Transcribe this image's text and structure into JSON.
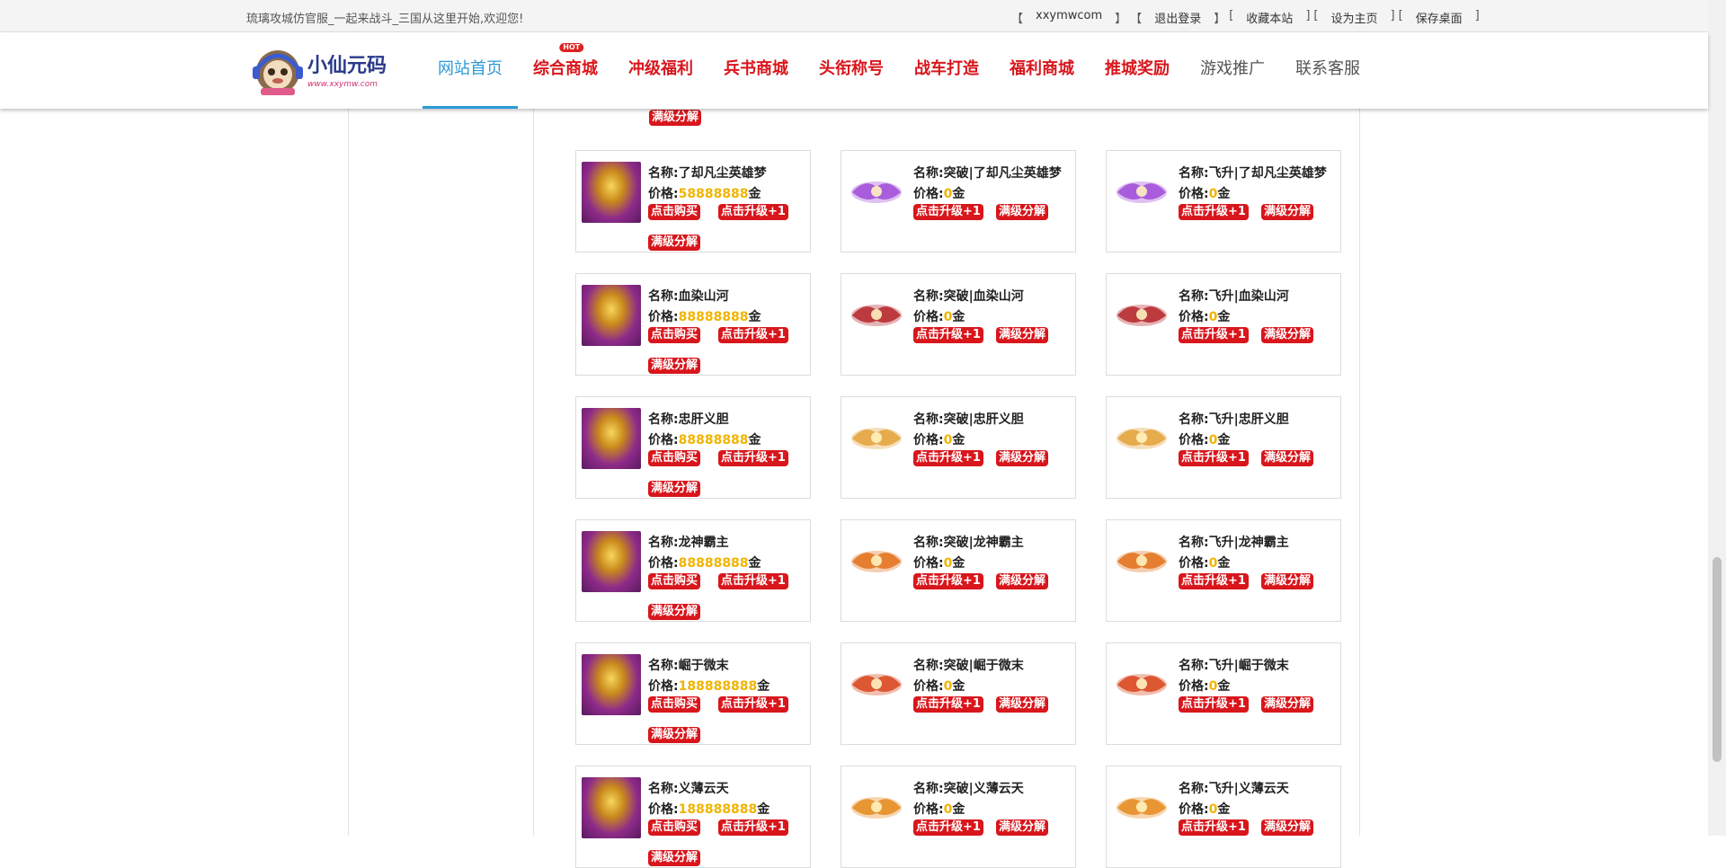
{
  "topbar": {
    "welcome": "琉璃攻城仿官服_一起来战斗_三国从这里开始,欢迎您!",
    "links": [
      "xxymwcom",
      "退出登录",
      "收藏本站",
      "设为主页",
      "保存桌面"
    ]
  },
  "logo": {
    "title": "小仙元码",
    "subtitle": "www.xxymw.com"
  },
  "nav": {
    "hot_badge": "HOT",
    "items": [
      {
        "label": "网站首页",
        "style": "active"
      },
      {
        "label": "综合商城",
        "style": "red",
        "hot": true
      },
      {
        "label": "冲级福利",
        "style": "red"
      },
      {
        "label": "兵书商城",
        "style": "red"
      },
      {
        "label": "头衔称号",
        "style": "red"
      },
      {
        "label": "战车打造",
        "style": "red"
      },
      {
        "label": "福利商城",
        "style": "red"
      },
      {
        "label": "推城奖励",
        "style": "red"
      },
      {
        "label": "游戏推广",
        "style": "gray"
      },
      {
        "label": "联系客服",
        "style": "gray"
      }
    ]
  },
  "labels": {
    "name": "名称:",
    "price": "价格:",
    "currency": "金",
    "buy": "点击购买",
    "upgrade": "点击升级+1",
    "disassemble": "满级分解"
  },
  "rows": [
    {
      "base": "了却凡尘英雄梦",
      "price": "58888888",
      "breakthrough": "突破|了却凡尘英雄梦",
      "ascend": "飞升|了却凡尘英雄梦",
      "fx_color": "#a04ad8"
    },
    {
      "base": "血染山河",
      "price": "88888888",
      "breakthrough": "突破|血染山河",
      "ascend": "飞升|血染山河",
      "fx_color": "#b5262a"
    },
    {
      "base": "忠肝义胆",
      "price": "88888888",
      "breakthrough": "突破|忠肝义胆",
      "ascend": "飞升|忠肝义胆",
      "fx_color": "#e3a23a"
    },
    {
      "base": "龙神霸主",
      "price": "88888888",
      "breakthrough": "突破|龙神霸主",
      "ascend": "飞升|龙神霸主",
      "fx_color": "#e2701b"
    },
    {
      "base": "崛于微末",
      "price": "188888888",
      "breakthrough": "突破|崛于微末",
      "ascend": "飞升|崛于微末",
      "fx_color": "#d8451c"
    },
    {
      "base": "义薄云天",
      "price": "188888888",
      "breakthrough": "突破|义薄云天",
      "ascend": "飞升|义薄云天",
      "fx_color": "#e58a1e"
    }
  ],
  "zero_price": "0"
}
